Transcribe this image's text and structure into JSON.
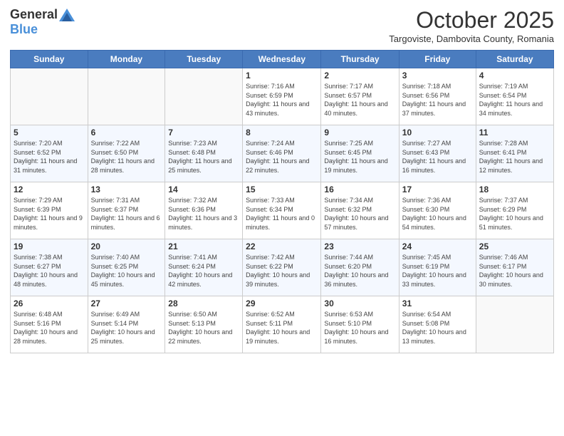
{
  "header": {
    "logo_general": "General",
    "logo_blue": "Blue",
    "month": "October 2025",
    "location": "Targoviste, Dambovita County, Romania"
  },
  "weekdays": [
    "Sunday",
    "Monday",
    "Tuesday",
    "Wednesday",
    "Thursday",
    "Friday",
    "Saturday"
  ],
  "weeks": [
    [
      {
        "day": "",
        "info": ""
      },
      {
        "day": "",
        "info": ""
      },
      {
        "day": "",
        "info": ""
      },
      {
        "day": "1",
        "info": "Sunrise: 7:16 AM\nSunset: 6:59 PM\nDaylight: 11 hours and 43 minutes."
      },
      {
        "day": "2",
        "info": "Sunrise: 7:17 AM\nSunset: 6:57 PM\nDaylight: 11 hours and 40 minutes."
      },
      {
        "day": "3",
        "info": "Sunrise: 7:18 AM\nSunset: 6:56 PM\nDaylight: 11 hours and 37 minutes."
      },
      {
        "day": "4",
        "info": "Sunrise: 7:19 AM\nSunset: 6:54 PM\nDaylight: 11 hours and 34 minutes."
      }
    ],
    [
      {
        "day": "5",
        "info": "Sunrise: 7:20 AM\nSunset: 6:52 PM\nDaylight: 11 hours and 31 minutes."
      },
      {
        "day": "6",
        "info": "Sunrise: 7:22 AM\nSunset: 6:50 PM\nDaylight: 11 hours and 28 minutes."
      },
      {
        "day": "7",
        "info": "Sunrise: 7:23 AM\nSunset: 6:48 PM\nDaylight: 11 hours and 25 minutes."
      },
      {
        "day": "8",
        "info": "Sunrise: 7:24 AM\nSunset: 6:46 PM\nDaylight: 11 hours and 22 minutes."
      },
      {
        "day": "9",
        "info": "Sunrise: 7:25 AM\nSunset: 6:45 PM\nDaylight: 11 hours and 19 minutes."
      },
      {
        "day": "10",
        "info": "Sunrise: 7:27 AM\nSunset: 6:43 PM\nDaylight: 11 hours and 16 minutes."
      },
      {
        "day": "11",
        "info": "Sunrise: 7:28 AM\nSunset: 6:41 PM\nDaylight: 11 hours and 12 minutes."
      }
    ],
    [
      {
        "day": "12",
        "info": "Sunrise: 7:29 AM\nSunset: 6:39 PM\nDaylight: 11 hours and 9 minutes."
      },
      {
        "day": "13",
        "info": "Sunrise: 7:31 AM\nSunset: 6:37 PM\nDaylight: 11 hours and 6 minutes."
      },
      {
        "day": "14",
        "info": "Sunrise: 7:32 AM\nSunset: 6:36 PM\nDaylight: 11 hours and 3 minutes."
      },
      {
        "day": "15",
        "info": "Sunrise: 7:33 AM\nSunset: 6:34 PM\nDaylight: 11 hours and 0 minutes."
      },
      {
        "day": "16",
        "info": "Sunrise: 7:34 AM\nSunset: 6:32 PM\nDaylight: 10 hours and 57 minutes."
      },
      {
        "day": "17",
        "info": "Sunrise: 7:36 AM\nSunset: 6:30 PM\nDaylight: 10 hours and 54 minutes."
      },
      {
        "day": "18",
        "info": "Sunrise: 7:37 AM\nSunset: 6:29 PM\nDaylight: 10 hours and 51 minutes."
      }
    ],
    [
      {
        "day": "19",
        "info": "Sunrise: 7:38 AM\nSunset: 6:27 PM\nDaylight: 10 hours and 48 minutes."
      },
      {
        "day": "20",
        "info": "Sunrise: 7:40 AM\nSunset: 6:25 PM\nDaylight: 10 hours and 45 minutes."
      },
      {
        "day": "21",
        "info": "Sunrise: 7:41 AM\nSunset: 6:24 PM\nDaylight: 10 hours and 42 minutes."
      },
      {
        "day": "22",
        "info": "Sunrise: 7:42 AM\nSunset: 6:22 PM\nDaylight: 10 hours and 39 minutes."
      },
      {
        "day": "23",
        "info": "Sunrise: 7:44 AM\nSunset: 6:20 PM\nDaylight: 10 hours and 36 minutes."
      },
      {
        "day": "24",
        "info": "Sunrise: 7:45 AM\nSunset: 6:19 PM\nDaylight: 10 hours and 33 minutes."
      },
      {
        "day": "25",
        "info": "Sunrise: 7:46 AM\nSunset: 6:17 PM\nDaylight: 10 hours and 30 minutes."
      }
    ],
    [
      {
        "day": "26",
        "info": "Sunrise: 6:48 AM\nSunset: 5:16 PM\nDaylight: 10 hours and 28 minutes."
      },
      {
        "day": "27",
        "info": "Sunrise: 6:49 AM\nSunset: 5:14 PM\nDaylight: 10 hours and 25 minutes."
      },
      {
        "day": "28",
        "info": "Sunrise: 6:50 AM\nSunset: 5:13 PM\nDaylight: 10 hours and 22 minutes."
      },
      {
        "day": "29",
        "info": "Sunrise: 6:52 AM\nSunset: 5:11 PM\nDaylight: 10 hours and 19 minutes."
      },
      {
        "day": "30",
        "info": "Sunrise: 6:53 AM\nSunset: 5:10 PM\nDaylight: 10 hours and 16 minutes."
      },
      {
        "day": "31",
        "info": "Sunrise: 6:54 AM\nSunset: 5:08 PM\nDaylight: 10 hours and 13 minutes."
      },
      {
        "day": "",
        "info": ""
      }
    ]
  ]
}
